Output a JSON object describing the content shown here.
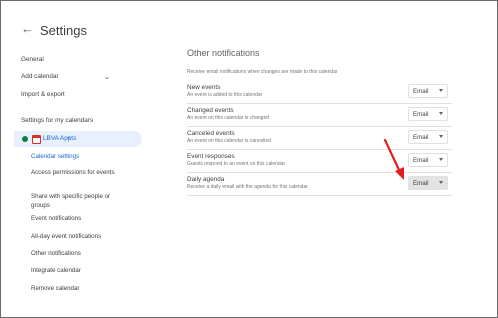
{
  "header": {
    "back_icon": "arrow-back-icon",
    "title": "Settings"
  },
  "sidebar": {
    "nav": [
      "General",
      "Add calendar",
      "Import & export"
    ],
    "section_title": "Settings for my calendars",
    "calendar": {
      "name": "LBVA Appts",
      "color": "#0b8043"
    },
    "sub_items": [
      "Calendar settings",
      "Access permissions for events",
      "Share with specific people or groups",
      "Event notifications",
      "All-day event notifications",
      "Other notifications",
      "Integrate calendar",
      "Remove calendar"
    ]
  },
  "main": {
    "heading": "Other notifications",
    "description": "Receive email notifications when changes are made to this calendar",
    "rows": [
      {
        "label": "New events",
        "desc": "An event is added to this calendar",
        "value": "Email"
      },
      {
        "label": "Changed events",
        "desc": "An event on this calendar is changed",
        "value": "Email"
      },
      {
        "label": "Canceled events",
        "desc": "An event on this calendar is cancelled",
        "value": "Email"
      },
      {
        "label": "Event responses",
        "desc": "Guests respond to an event on this calendar",
        "value": "Email"
      },
      {
        "label": "Daily agenda",
        "desc": "Receive a daily email with the agenda for this calendar",
        "value": "Email"
      }
    ]
  },
  "colors": {
    "accent": "#1967d2",
    "annotation_arrow": "#e02020"
  }
}
